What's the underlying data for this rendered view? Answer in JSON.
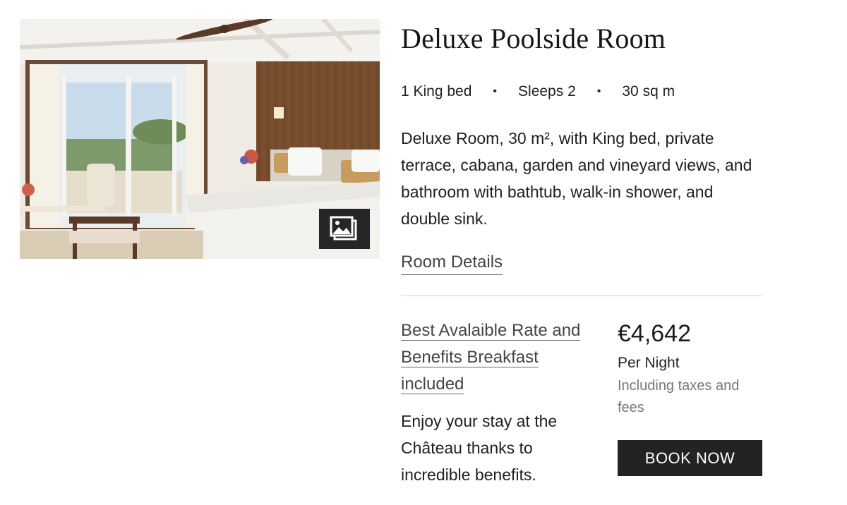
{
  "room": {
    "image_alt": "Deluxe Poolside Room photo",
    "gallery_icon": "gallery-icon",
    "title": "Deluxe Poolside Room",
    "facts": [
      "1 King bed",
      "Sleeps 2",
      "30 sq m"
    ],
    "separator": "•",
    "description": "Deluxe Room, 30 m², with King bed, private terrace, cabana, garden and vineyard views, and bathroom with bathtub, walk-in shower, and double sink.",
    "details_link": "Room Details"
  },
  "rate": {
    "name_lines": [
      "Best Avalaible Rate and",
      "Benefits Breakfast",
      "included"
    ],
    "description": "Enjoy your stay at the Château thanks to incredible benefits.",
    "price": "€4,642",
    "per_night": "Per Night",
    "taxes_note": "Including taxes and fees",
    "book_label": "BOOK NOW"
  },
  "colors": {
    "button_bg": "#232323",
    "button_text": "#ffffff",
    "link": "#444444",
    "divider": "#d2d2d2"
  }
}
